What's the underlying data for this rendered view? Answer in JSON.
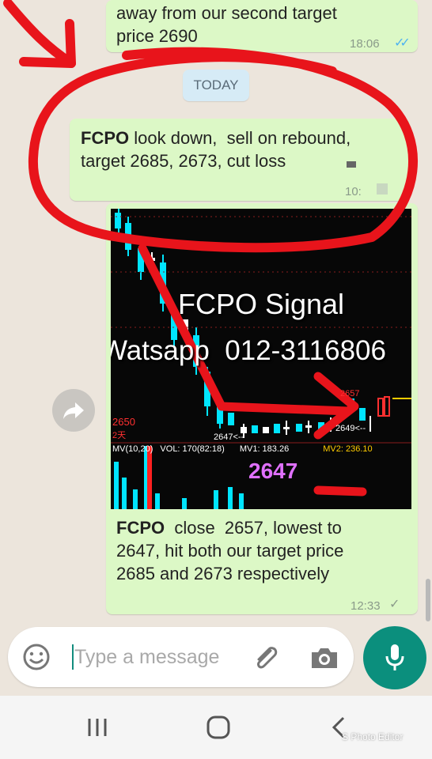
{
  "messages": [
    {
      "line1": "away from our second target",
      "line2": "price 2690",
      "time": "18:06",
      "ticks": "✓✓"
    },
    {
      "bold": "FCPO",
      "line1_rest": " look down,  sell on rebound,",
      "line2": "target 2685, 2673, cut loss",
      "time": "10:"
    },
    {
      "caption_bold": "FCPO",
      "caption_line1_rest": "  close  2657, lowest to",
      "caption_line2": "2647, hit both our target price",
      "caption_line3": "2685 and 2673 respectively",
      "time": "12:33",
      "ticks": "✓"
    }
  ],
  "date_chip": "TODAY",
  "chart_image": {
    "overlay_title": "FCPO Signal",
    "overlay_contact": "Watsapp  012-3116806",
    "price_left": "2650",
    "price_left_sub": "2天",
    "label_low_left": "2647<--",
    "label_high": "2657",
    "label_low_right": "2649<--",
    "indicator_mv": "MV(10,20)",
    "indicator_vol": "VOL: 170(82:18)",
    "indicator_mv1": "MV1: 183.26",
    "indicator_mv2": "MV2: 236.10",
    "big_label": "2647"
  },
  "input": {
    "placeholder": "Type a message"
  },
  "watermark": "S Photo Editor",
  "colors": {
    "bubble": "#dcf8c6",
    "accent": "#0b8f7d",
    "annotation": "#e8141b",
    "chip": "#d6ebf6"
  }
}
